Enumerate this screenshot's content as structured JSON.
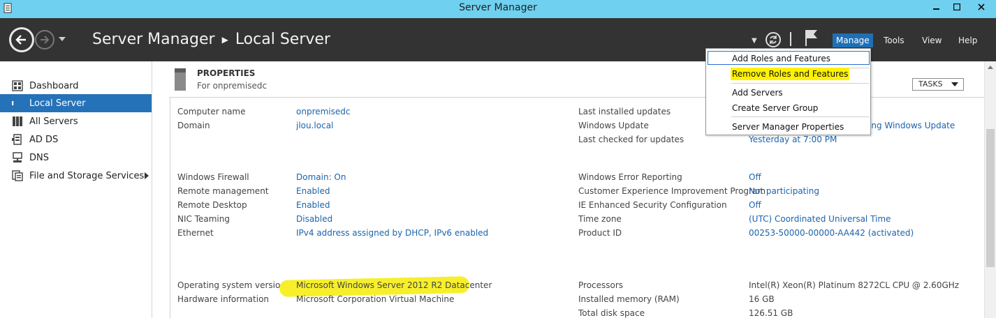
{
  "window": {
    "title": "Server Manager"
  },
  "header": {
    "breadcrumb_root": "Server Manager",
    "breadcrumb_current": "Local Server",
    "menus": {
      "manage": "Manage",
      "tools": "Tools",
      "view": "View",
      "help": "Help"
    }
  },
  "sidebar": {
    "items": [
      {
        "label": "Dashboard",
        "icon": "dashboard-icon"
      },
      {
        "label": "Local Server",
        "icon": "local-server-icon"
      },
      {
        "label": "All Servers",
        "icon": "all-servers-icon"
      },
      {
        "label": "AD DS",
        "icon": "ad-ds-icon"
      },
      {
        "label": "DNS",
        "icon": "dns-icon"
      },
      {
        "label": "File and Storage Services",
        "icon": "file-storage-icon"
      }
    ],
    "active": "Local Server"
  },
  "properties": {
    "title": "PROPERTIES",
    "subtitle": "For onpremisedc",
    "tasks_label": "TASKS",
    "left": [
      {
        "label": "Computer name",
        "value": "onpremisedc"
      },
      {
        "label": "Domain",
        "value": "jlou.local"
      },
      {
        "label": "Windows Firewall",
        "value": "Domain: On"
      },
      {
        "label": "Remote management",
        "value": "Enabled"
      },
      {
        "label": "Remote Desktop",
        "value": "Enabled"
      },
      {
        "label": "NIC Teaming",
        "value": "Disabled"
      },
      {
        "label": "Ethernet",
        "value": "IPv4 address assigned by DHCP, IPv6 enabled"
      },
      {
        "label": "Operating system version",
        "value": "Microsoft Windows Server 2012 R2 Datacenter"
      },
      {
        "label": "Hardware information",
        "value": "Microsoft Corporation Virtual Machine"
      }
    ],
    "right": [
      {
        "label": "Last installed updates",
        "value": ""
      },
      {
        "label": "Windows Update",
        "value": "ing Windows Update"
      },
      {
        "label": "Last checked for updates",
        "value": "Yesterday at 7:00 PM"
      },
      {
        "label": "Windows Error Reporting",
        "value": "Off"
      },
      {
        "label": "Customer Experience Improvement Program",
        "value": "Not participating"
      },
      {
        "label": "IE Enhanced Security Configuration",
        "value": "Off"
      },
      {
        "label": "Time zone",
        "value": "(UTC) Coordinated Universal Time"
      },
      {
        "label": "Product ID",
        "value": "00253-50000-00000-AA442 (activated)"
      },
      {
        "label": "Processors",
        "value": "Intel(R) Xeon(R) Platinum 8272CL CPU @ 2.60GHz"
      },
      {
        "label": "Installed memory (RAM)",
        "value": "16 GB"
      },
      {
        "label": "Total disk space",
        "value": "126.51 GB"
      }
    ]
  },
  "manage_menu": {
    "items": [
      "Add Roles and Features",
      "Remove Roles and Features",
      "Add Servers",
      "Create Server Group",
      "Server Manager Properties"
    ]
  },
  "colors": {
    "title_bar": "#6fd0f0",
    "header": "#333333",
    "accent": "#2672b8",
    "link": "#1b63ad",
    "highlight": "#fff200"
  }
}
